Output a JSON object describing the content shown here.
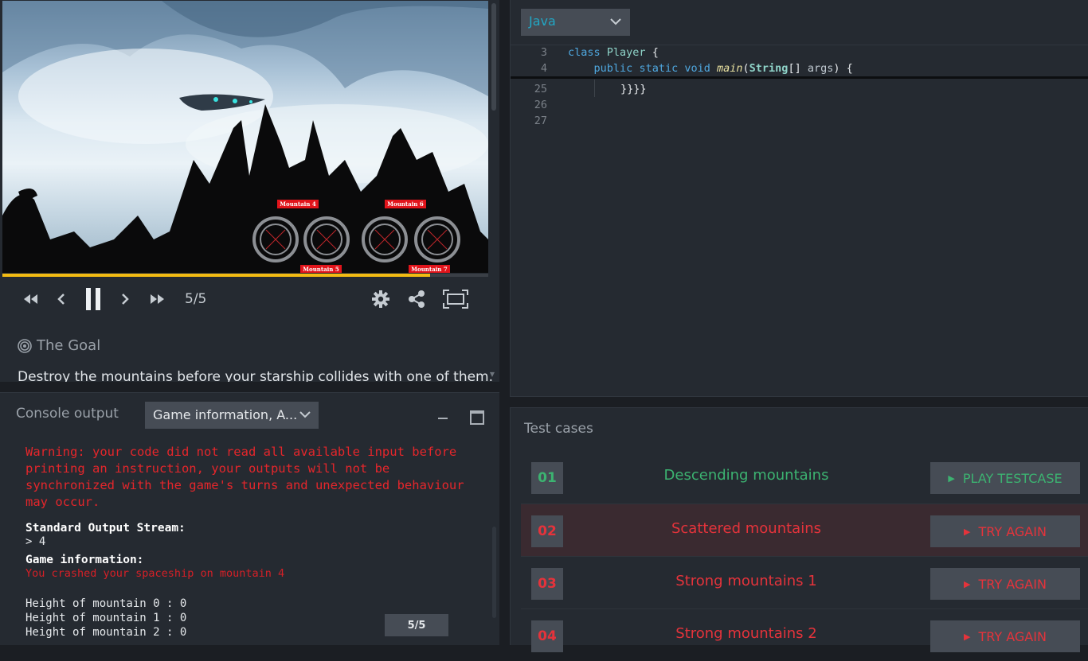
{
  "viewer": {
    "frame_counter": "5/5",
    "progress_fraction": 0.88,
    "scene_labels": [
      "Mountain 4",
      "Mountain 6",
      "Mountain 5",
      "Mountain 7"
    ],
    "goal_heading": "The Goal",
    "goal_text": "Destroy the mountains before your starship collides with one of them.",
    "icons": [
      "rewind-icon",
      "step-back-icon",
      "pause-icon",
      "step-forward-icon",
      "fast-forward-icon",
      "gear-icon",
      "share-icon",
      "fullscreen-icon"
    ]
  },
  "console": {
    "title": "Console output",
    "filter_value": "Game information, A...",
    "warning": "Warning: your code did not read all available input before printing an instruction, your outputs will not be synchronized with the game's turns and unexpected behaviour may occur.",
    "stdout_title": "Standard Output Stream:",
    "stdout_line": "> 4",
    "gameinfo_title": "Game information:",
    "gameinfo_line": "You crashed your spaceship on mountain 4",
    "heights": [
      "Height of mountain 0 : 0",
      "Height of mountain 1 : 0",
      "Height of mountain 2 : 0"
    ],
    "frame_badge": "5/5"
  },
  "editor": {
    "language": "Java",
    "lines": [
      {
        "n": "3",
        "text": "class Player {"
      },
      {
        "n": "4",
        "text": "    public static void main(String[] args) {"
      },
      {
        "n": "25",
        "text": "}}}}"
      },
      {
        "n": "26",
        "text": ""
      },
      {
        "n": "27",
        "text": ""
      }
    ]
  },
  "tests": {
    "title": "Test cases",
    "items": [
      {
        "num": "01",
        "name": "Descending mountains",
        "status": "pass",
        "button": "PLAY TESTCASE"
      },
      {
        "num": "02",
        "name": "Scattered mountains",
        "status": "fail",
        "button": "TRY AGAIN"
      },
      {
        "num": "03",
        "name": "Strong mountains 1",
        "status": "fail",
        "button": "TRY AGAIN"
      },
      {
        "num": "04",
        "name": "Strong mountains 2",
        "status": "fail",
        "button": "TRY AGAIN"
      }
    ]
  },
  "colors": {
    "accent_yellow": "#f2bb13",
    "pass_green": "#3cb371",
    "fail_red": "#e5333b",
    "java_blue": "#22a6c4"
  }
}
